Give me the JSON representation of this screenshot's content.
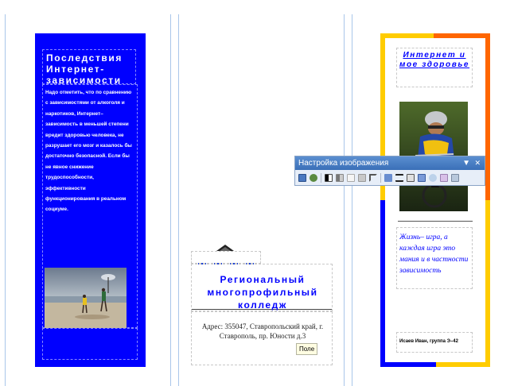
{
  "left_panel": {
    "title": "Последствия Интернет-зависимости",
    "body": "Надо отметить, что по сравнению с зависимостями от алкоголя и наркотиков, Интернет– зависимость в меньшей степени вредит здоровью человека, не разрушает его мозг и казалось бы достаточно безопасной. Если бы не явное снижение трудоспособности, эффективности функционирования в реальном социуме."
  },
  "middle_panel": {
    "title": "Региональный многопрофильный колледж",
    "address": "Адрес: 355047, Ставропольский край, г. Ставрополь, пр. Юности д.3",
    "tooltip": "Поле"
  },
  "right_panel": {
    "title": "Интернет и мое здоровье",
    "quote": "Жизнь– игра, а каждая игра это мания и в частности зависимость",
    "author": "Исаев Иван, группа Э–42"
  },
  "toolbar": {
    "title": "Настройка изображения",
    "buttons": [
      "insert-picture",
      "color",
      "more-contrast",
      "less-contrast",
      "more-brightness",
      "less-brightness",
      "crop",
      "line-style",
      "compress",
      "format-picture",
      "set-transparent",
      "recolor",
      "reset"
    ]
  },
  "colors": {
    "brand_blue": "#0000ff",
    "orange": "#ff6600",
    "yellow": "#ffcc00"
  }
}
